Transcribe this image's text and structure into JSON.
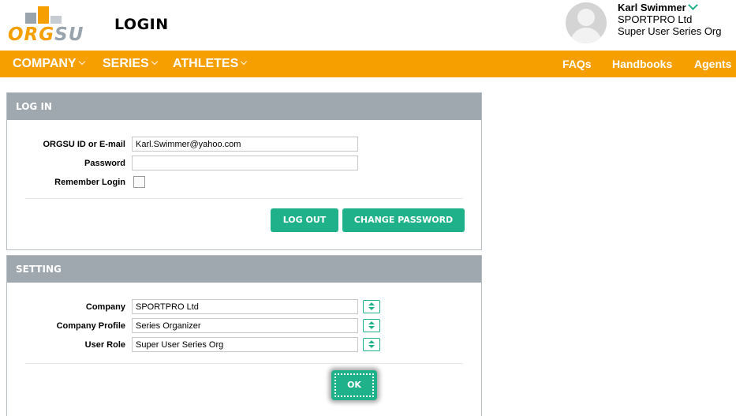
{
  "header": {
    "logo_text_a": "ORG",
    "logo_text_b": "SU",
    "page_title": "LOGIN",
    "user": {
      "name": "Karl Swimmer",
      "company": "SPORTPRO Ltd",
      "role": "Super User Series Org"
    }
  },
  "nav": {
    "left": [
      {
        "label": "COMPANY"
      },
      {
        "label": "SERIES"
      },
      {
        "label": "ATHLETES"
      }
    ],
    "right": [
      {
        "label": "FAQs"
      },
      {
        "label": "Handbooks"
      },
      {
        "label": "Agents"
      }
    ]
  },
  "login_panel": {
    "title": "LOG IN",
    "id_label": "ORGSU ID or E-mail",
    "id_value": "Karl.Swimmer@yahoo.com",
    "password_label": "Password",
    "password_value": "",
    "remember_label": "Remember Login",
    "remember_checked": false,
    "logout_label": "LOG OUT",
    "change_password_label": "CHANGE PASSWORD"
  },
  "setting_panel": {
    "title": "SETTING",
    "company_label": "Company",
    "company_value": "SPORTPRO Ltd",
    "profile_label": "Company Profile",
    "profile_value": "Series Organizer",
    "role_label": "User Role",
    "role_value": "Super User Series Org",
    "ok_label": "OK"
  },
  "colors": {
    "brand_orange": "#f5a000",
    "accent_green": "#1fb28a",
    "panel_header_gray": "#9fa8ae"
  }
}
